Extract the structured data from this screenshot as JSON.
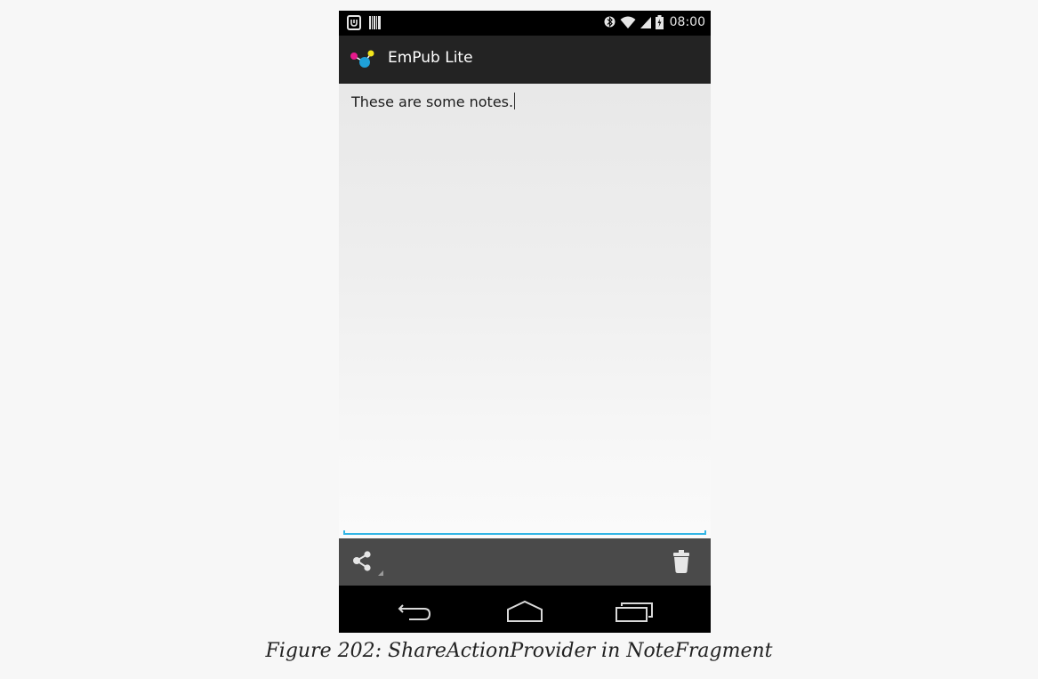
{
  "status_bar": {
    "left_icons": [
      "notification-app-icon",
      "barcode-icon"
    ],
    "right_icons": [
      "bluetooth-icon",
      "wifi-icon",
      "signal-icon",
      "battery-icon"
    ],
    "time": "08:00"
  },
  "action_bar": {
    "app_icon": "empub-logo-icon",
    "title": "EmPub Lite"
  },
  "note": {
    "text": "These are some notes.",
    "accent_color": "#33b5e5"
  },
  "split_action_bar": {
    "share_icon": "share-icon",
    "delete_icon": "trash-icon"
  },
  "navigation_bar": {
    "buttons": [
      "back-icon",
      "home-icon",
      "recents-icon"
    ]
  },
  "caption": "Figure 202: ShareActionProvider in NoteFragment"
}
